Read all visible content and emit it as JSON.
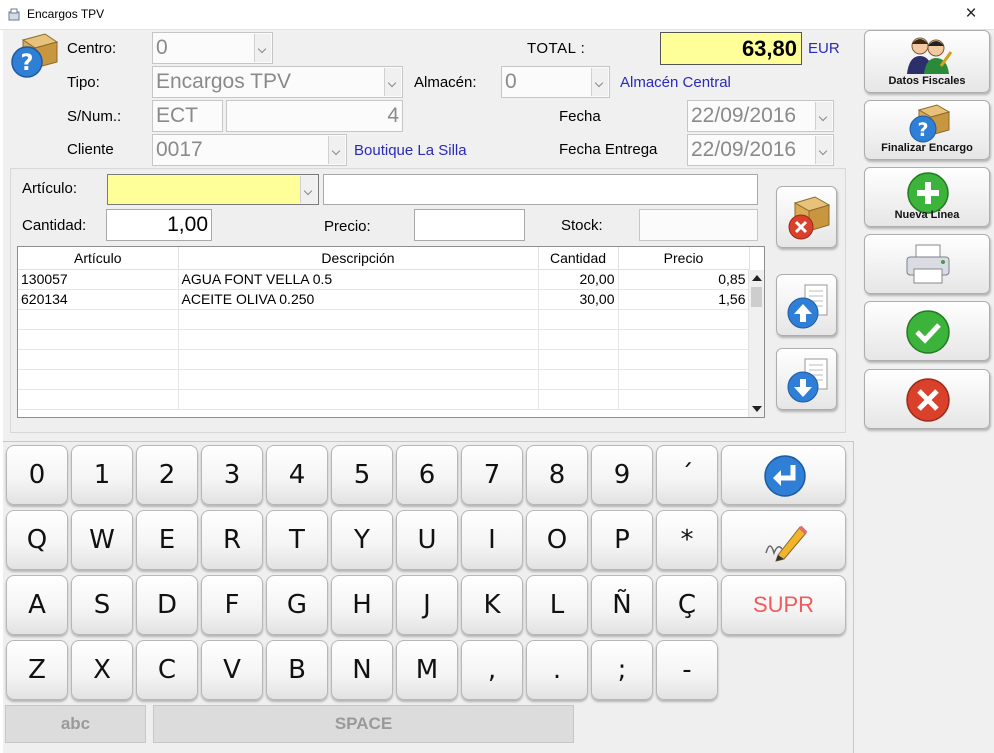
{
  "window": {
    "title": "Encargos TPV",
    "close": "×"
  },
  "header": {
    "centro_label": "Centro:",
    "centro_value": "0",
    "tipo_label": "Tipo:",
    "tipo_value": "Encargos TPV",
    "snum_label": "S/Num.:",
    "snum_series": "ECT",
    "snum_number": "4",
    "cliente_label": "Cliente",
    "cliente_code": "0017",
    "cliente_name": "Boutique La Silla",
    "almacen_label": "Almacén:",
    "almacen_value": "0",
    "almacen_name": "Almacén Central",
    "total_label": "TOTAL :",
    "total_value": "63,80",
    "currency": "EUR",
    "fecha_label": "Fecha",
    "fecha_value": "22/09/2016",
    "fecha_entrega_label": "Fecha Entrega",
    "fecha_entrega_value": "22/09/2016"
  },
  "entry": {
    "articulo_label": "Artículo:",
    "articulo_code": "",
    "articulo_desc": "",
    "cantidad_label": "Cantidad:",
    "cantidad_value": "1,00",
    "precio_label": "Precio:",
    "precio_value": "",
    "stock_label": "Stock:",
    "stock_value": ""
  },
  "grid": {
    "columns": [
      "Artículo",
      "Descripción",
      "Cantidad",
      "Precio"
    ],
    "rows": [
      [
        "130057",
        "AGUA FONT VELLA 0.5",
        "20,00",
        "0,85"
      ],
      [
        "620134",
        "ACEITE OLIVA 0.250",
        "30,00",
        "1,56"
      ]
    ]
  },
  "side": {
    "datos_fiscales": "Datos Fiscales",
    "finalizar_encargo": "Finalizar Encargo",
    "nueva_linea": "Nueva Línea"
  },
  "keyboard": {
    "row1": [
      "0",
      "1",
      "2",
      "3",
      "4",
      "5",
      "6",
      "7",
      "8",
      "9",
      "´"
    ],
    "row2": [
      "Q",
      "W",
      "E",
      "R",
      "T",
      "Y",
      "U",
      "I",
      "O",
      "P",
      "*"
    ],
    "row3": [
      "A",
      "S",
      "D",
      "F",
      "G",
      "H",
      "J",
      "K",
      "L",
      "Ñ",
      "Ç"
    ],
    "row4": [
      "Z",
      "X",
      "C",
      "V",
      "B",
      "N",
      "M",
      ",",
      ".",
      ";",
      "-"
    ],
    "supr": "SUPR",
    "abc": "abc",
    "space": "SPACE"
  },
  "colors": {
    "field_yellow": "#ffff99",
    "link_blue": "#2a2ab8",
    "supr_red": "#f05a5a"
  }
}
